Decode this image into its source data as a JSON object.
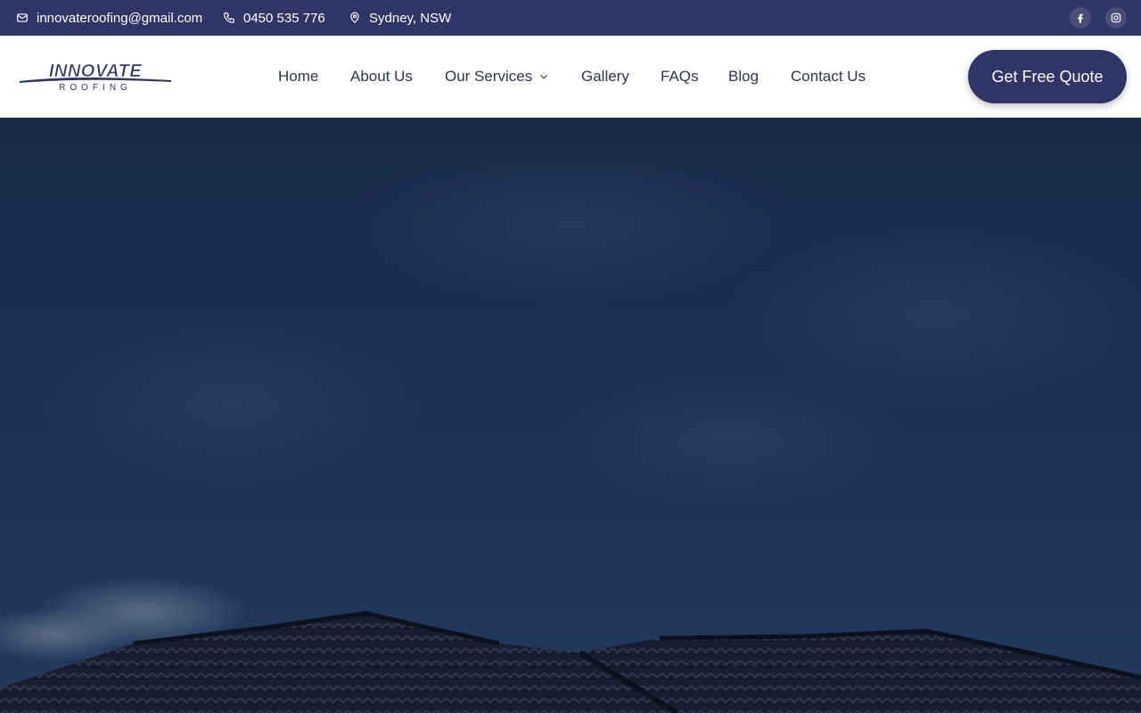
{
  "topbar": {
    "email": "innovateroofing@gmail.com",
    "phone": "0450 535 776",
    "location": "Sydney, NSW",
    "icons": [
      "mail-icon",
      "phone-icon",
      "location-pin-icon",
      "facebook-icon",
      "instagram-icon"
    ]
  },
  "header": {
    "logo": {
      "main": "INNOVATE",
      "sub": "ROOFING"
    },
    "nav": {
      "home": "Home",
      "about": "About Us",
      "services": "Our Services",
      "gallery": "Gallery",
      "faqs": "FAQs",
      "blog": "Blog",
      "contact": "Contact Us"
    },
    "cta_label": "Get Free Quote"
  },
  "colors": {
    "brand_navy": "#2f3564",
    "nav_text": "#2e3550",
    "hero_sky": "#203a62",
    "white": "#ffffff"
  }
}
